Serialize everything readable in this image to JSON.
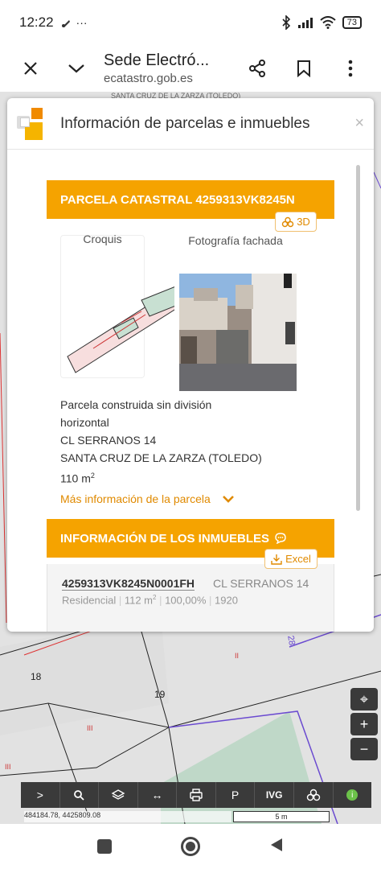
{
  "status_bar": {
    "time": "12:22",
    "battery": "73",
    "more": "···"
  },
  "browser": {
    "title": "Sede Electró...",
    "url": "ecatastro.gob.es",
    "icons": [
      "close-icon",
      "chevron-down-icon",
      "share-icon",
      "bookmark-icon",
      "more-vert-icon"
    ]
  },
  "map": {
    "strip_text": "SANTA CRUZ DE LA ZARZA (TOLEDO)",
    "labels": [
      "18",
      "19",
      "II",
      "III",
      "III",
      "28"
    ],
    "coords": "484184.78, 4425809.08",
    "scale": "5 m",
    "controls": {
      "locate": "⌖",
      "zoom_in": "+",
      "zoom_out": "−"
    },
    "toolbar": [
      ">",
      "search",
      "layers",
      "↔",
      "print",
      "P",
      "IVG",
      "3d",
      "i"
    ]
  },
  "modal": {
    "title": "Información de parcelas e inmuebles",
    "close": "×",
    "parcel": {
      "header": "PARCELA CATASTRAL 4259313VK8245N",
      "btn_3d": "3D",
      "croquis_label": "Croquis",
      "photo_label": "Fotografía fachada",
      "description_line1": "Parcela construida sin división",
      "description_line2": "horizontal",
      "address": "CL SERRANOS 14",
      "locality": "SANTA CRUZ DE LA ZARZA (TOLEDO)",
      "area": "110 m",
      "area_sup": "2",
      "more_info": "Más información de la parcela"
    },
    "inmuebles": {
      "header": "INFORMACIÓN DE LOS INMUEBLES",
      "excel": "Excel",
      "items": [
        {
          "ref": "4259313VK8245N0001FH",
          "address": "CL SERRANOS 14",
          "use": "Residencial",
          "surface": "112 m",
          "surface_sup": "2",
          "participation": "100,00%",
          "year": "1920"
        }
      ]
    }
  },
  "colors": {
    "accent": "#f5a300",
    "accent_text": "#e08a00",
    "map_bg": "#e3e4e3",
    "toolbar": "#3a3a3a"
  }
}
